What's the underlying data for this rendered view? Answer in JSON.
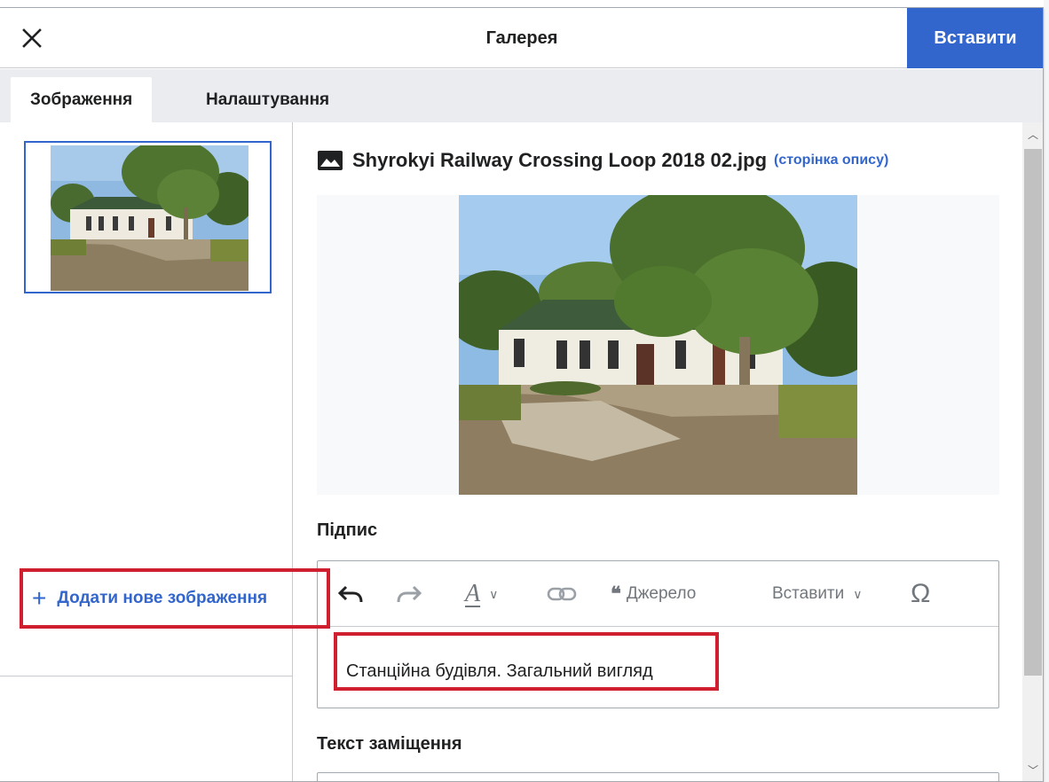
{
  "dialog": {
    "title": "Галерея",
    "insert_label": "Вставити",
    "close_icon": "close-icon"
  },
  "tabs": [
    {
      "label": "Зображення",
      "active": true
    },
    {
      "label": "Налаштування",
      "active": false
    }
  ],
  "left_panel": {
    "thumbnail_alt": "Shyrokyi Railway Crossing Loop 2018 02.jpg",
    "add_image_icon": "+",
    "add_image_label": "Додати нове зображення"
  },
  "file": {
    "name": "Shyrokyi Railway Crossing Loop 2018 02.jpg",
    "description_link": "(сторінка опису)",
    "icon": "image-icon"
  },
  "caption": {
    "label": "Підпис",
    "text": "Станційна будівля. Загальний вигляд"
  },
  "toolbar": {
    "undo_icon": "undo-icon",
    "redo_icon": "redo-icon",
    "style_glyph": "A",
    "link_icon": "link-icon",
    "cite_label": "Джерело",
    "insert_label": "Вставити",
    "special_char_glyph": "Ω"
  },
  "alt_text": {
    "label": "Текст заміщення",
    "value": ""
  },
  "colors": {
    "accent": "#3366cc",
    "highlight": "#d0202f",
    "tabbar": "#eaecf0",
    "border": "#c8ccd1"
  }
}
